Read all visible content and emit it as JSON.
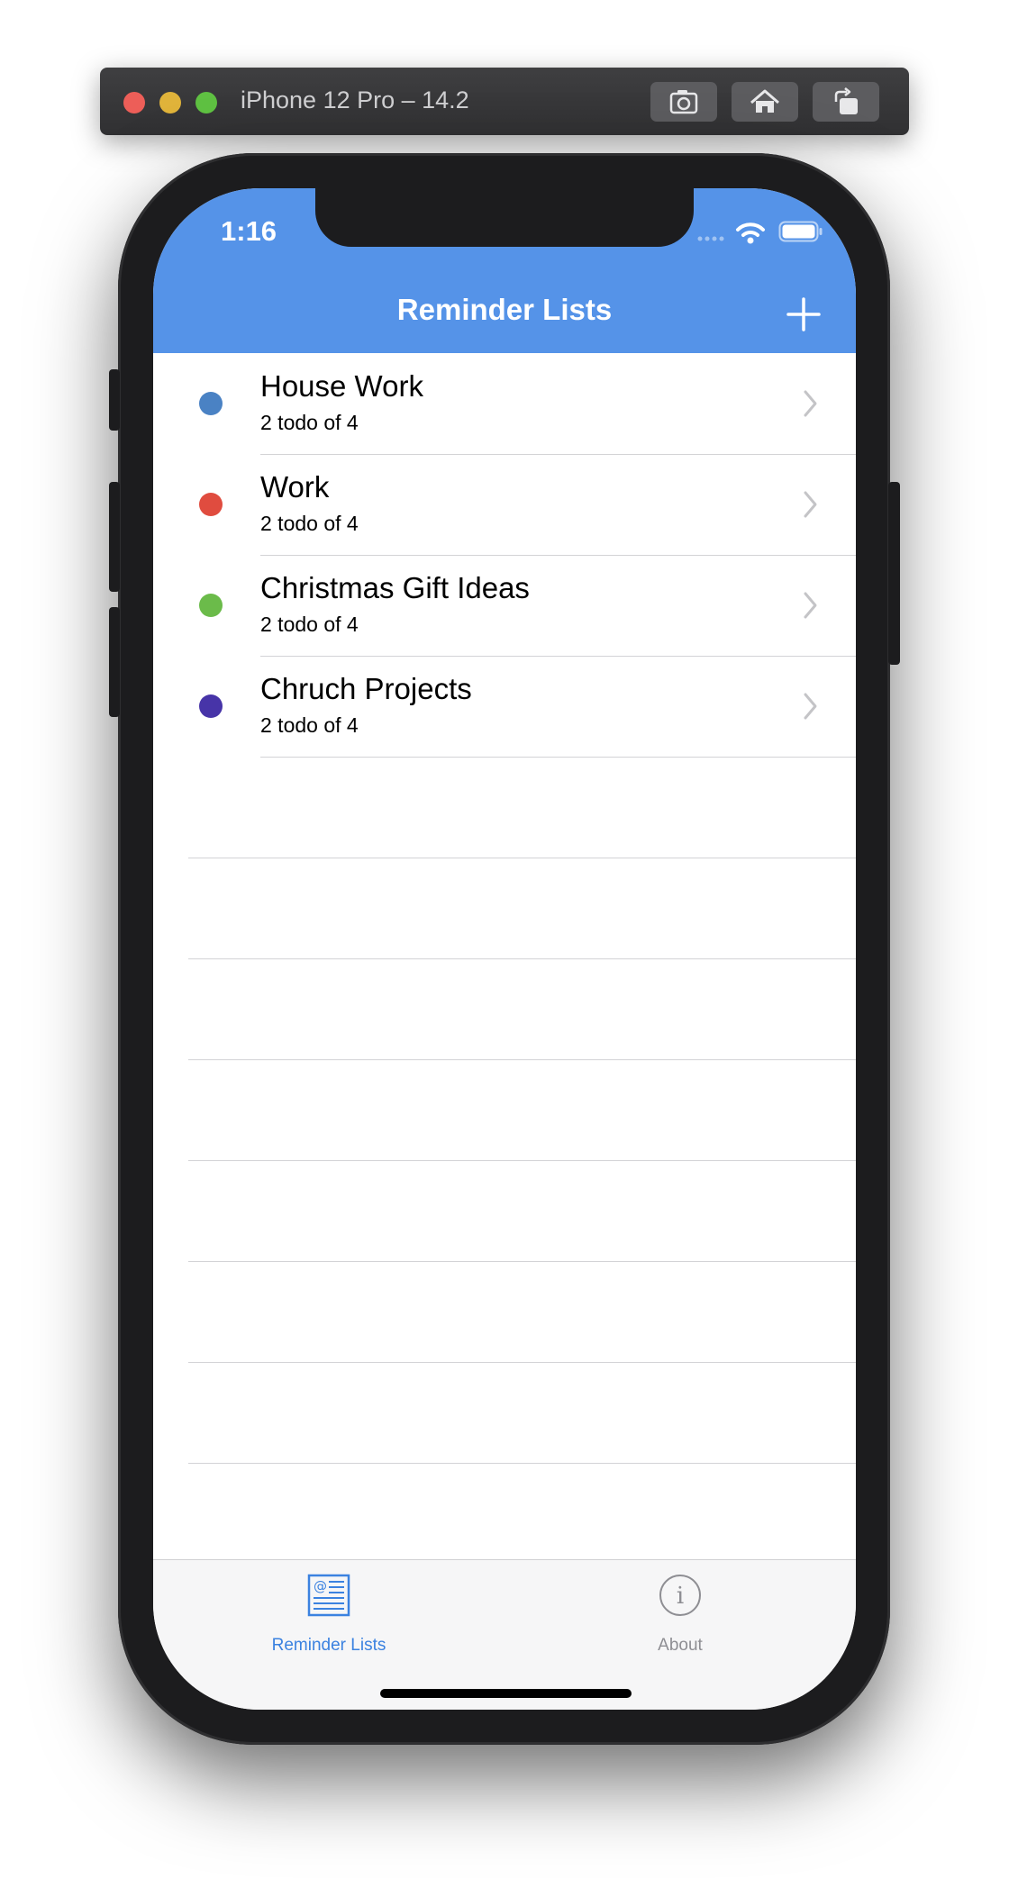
{
  "window": {
    "title": "iPhone 12 Pro – 14.2",
    "buttons": [
      "screenshot-icon",
      "home-icon",
      "rotate-icon"
    ]
  },
  "status_bar": {
    "time": "1:16"
  },
  "nav": {
    "title": "Reminder Lists",
    "add_icon": "plus-icon"
  },
  "lists": [
    {
      "title": "House Work",
      "subtitle": "2 todo of 4",
      "color": "#4a82c4"
    },
    {
      "title": "Work",
      "subtitle": "2 todo of 4",
      "color": "#e04c3f"
    },
    {
      "title": "Christmas Gift Ideas",
      "subtitle": "2 todo of 4",
      "color": "#6bbb4a"
    },
    {
      "title": "Chruch Projects",
      "subtitle": "2 todo of 4",
      "color": "#4734a8"
    }
  ],
  "tabs": [
    {
      "label": "Reminder Lists",
      "icon": "newspaper-icon",
      "active": true
    },
    {
      "label": "About",
      "icon": "info-icon",
      "active": false
    }
  ],
  "colors": {
    "accent": "#5593e8",
    "tab_active": "#3b82e0",
    "tab_inactive": "#8e8e93"
  }
}
